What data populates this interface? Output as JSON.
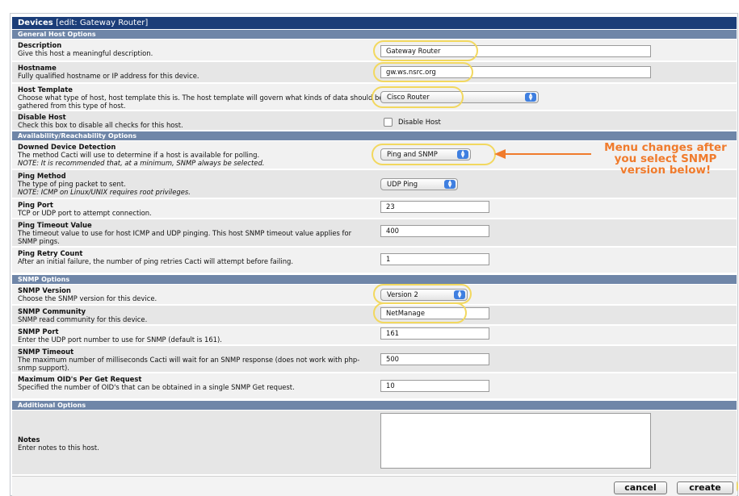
{
  "title": {
    "main": "Devices",
    "edit": "[edit: Gateway Router]"
  },
  "sections": {
    "general": "General Host Options",
    "availability": "Availability/Reachability Options",
    "snmp": "SNMP Options",
    "additional": "Additional Options"
  },
  "fields": {
    "description": {
      "title": "Description",
      "desc": "Give this host a meaningful description.",
      "value": "Gateway Router"
    },
    "hostname": {
      "title": "Hostname",
      "desc": "Fully qualified hostname or IP address for this device.",
      "value": "gw.ws.nsrc.org"
    },
    "host_template": {
      "title": "Host Template",
      "desc": "Choose what type of host, host template this is. The host template will govern what kinds of data should be gathered from this type of host.",
      "value": "Cisco Router"
    },
    "disable_host": {
      "title": "Disable Host",
      "desc": "Check this box to disable all checks for this host.",
      "checkbox_label": "Disable Host"
    },
    "downed_detection": {
      "title": "Downed Device Detection",
      "desc": "The method Cacti will use to determine if a host is available for polling.",
      "note": "NOTE: It is recommended that, at a minimum, SNMP always be selected.",
      "value": "Ping and SNMP"
    },
    "ping_method": {
      "title": "Ping Method",
      "desc": "The type of ping packet to sent.",
      "note": "NOTE: ICMP on Linux/UNIX requires root privileges.",
      "value": "UDP Ping"
    },
    "ping_port": {
      "title": "Ping Port",
      "desc": "TCP or UDP port to attempt connection.",
      "value": "23"
    },
    "ping_timeout": {
      "title": "Ping Timeout Value",
      "desc": "The timeout value to use for host ICMP and UDP pinging. This host SNMP timeout value applies for SNMP pings.",
      "value": "400"
    },
    "ping_retry": {
      "title": "Ping Retry Count",
      "desc": "After an initial failure, the number of ping retries Cacti will attempt before failing.",
      "value": "1"
    },
    "snmp_version": {
      "title": "SNMP Version",
      "desc": "Choose the SNMP version for this device.",
      "value": "Version 2"
    },
    "snmp_community": {
      "title": "SNMP Community",
      "desc": "SNMP read community for this device.",
      "value": "NetManage"
    },
    "snmp_port": {
      "title": "SNMP Port",
      "desc": "Enter the UDP port number to use for SNMP (default is 161).",
      "value": "161"
    },
    "snmp_timeout": {
      "title": "SNMP Timeout",
      "desc": "The maximum number of milliseconds Cacti will wait for an SNMP response (does not work with php-snmp support).",
      "value": "500"
    },
    "max_oids": {
      "title": "Maximum OID's Per Get Request",
      "desc": "Specified the number of OID's that can be obtained in a single SNMP Get request.",
      "value": "10"
    },
    "notes": {
      "title": "Notes",
      "desc": "Enter notes to this host.",
      "value": ""
    }
  },
  "annotation": "Menu changes after you select SNMP version below!",
  "buttons": {
    "cancel": "cancel",
    "create": "create"
  },
  "colors": {
    "title_bar": "#1b3d78",
    "section_bar": "#6f86a8",
    "highlight": "#f2d85f",
    "annotation": "#f07b2c"
  }
}
